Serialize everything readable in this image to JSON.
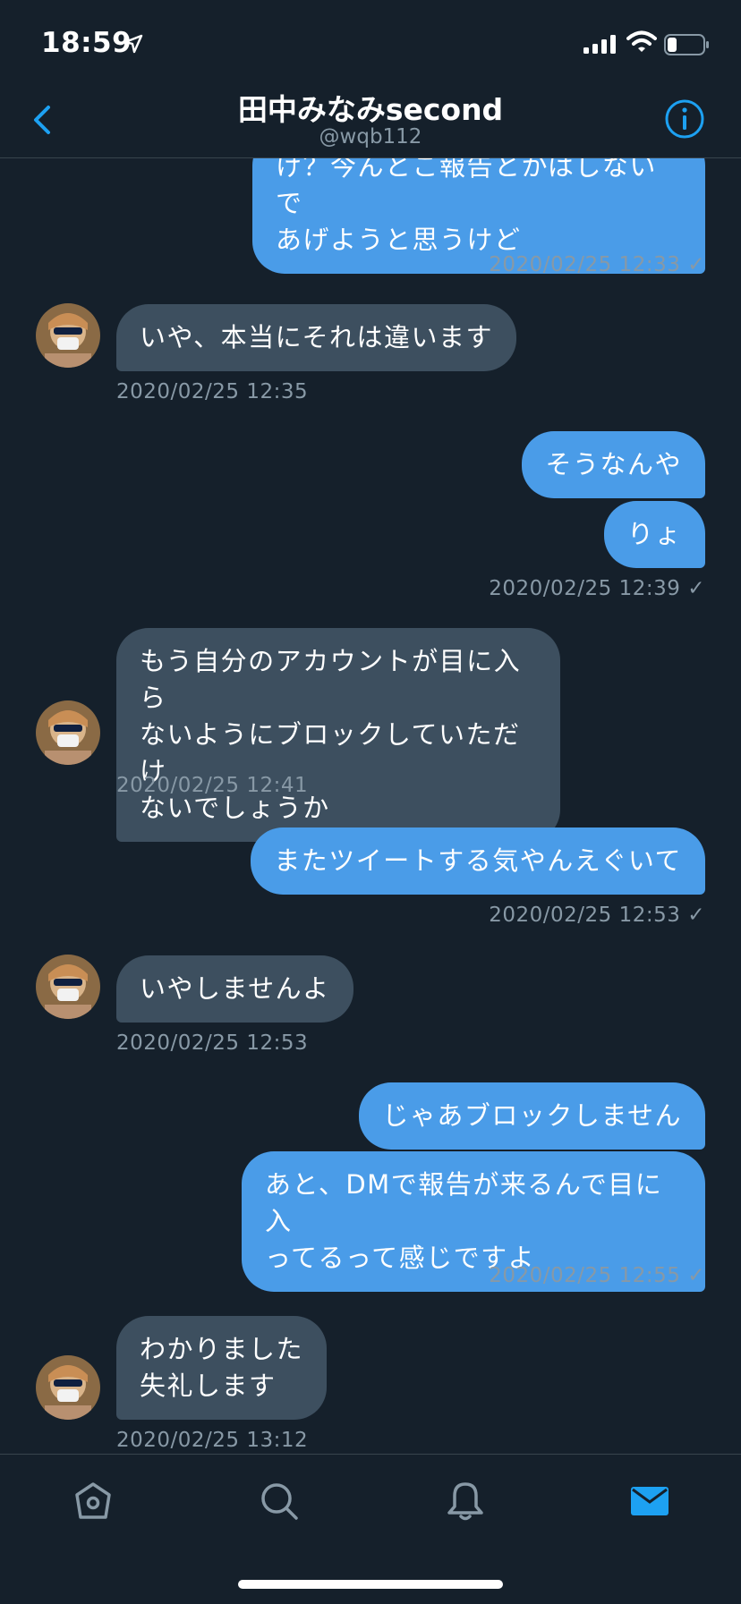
{
  "status_bar": {
    "time": "18:59",
    "icons": [
      "location-arrow-icon",
      "cellular-signal-icon",
      "wifi-icon",
      "battery-icon"
    ]
  },
  "header": {
    "title": "田中みなみsecond",
    "handle": "@wqb112",
    "back_icon": "chevron-left-icon",
    "info_icon": "info-icon"
  },
  "colors": {
    "background": "#15202b",
    "sent_bubble": "#4a9ce8",
    "received_bubble": "#3d4f5f",
    "accent": "#1da1f2",
    "muted_text": "#8899a6"
  },
  "conversation": [
    {
      "side": "sent",
      "text": "け？今んとこ報告とかはしないで\nあげようと思うけど"
    },
    {
      "side": "sent_ts",
      "timestamp": "2020/02/25 12:33 ✓"
    },
    {
      "side": "received",
      "text": "いや、本当にそれは違います"
    },
    {
      "side": "received_ts",
      "timestamp": "2020/02/25 12:35"
    },
    {
      "side": "sent",
      "text": "そうなんや"
    },
    {
      "side": "sent",
      "text": "りょ"
    },
    {
      "side": "sent_ts",
      "timestamp": "2020/02/25 12:39 ✓"
    },
    {
      "side": "received",
      "text": "もう自分のアカウントが目に入ら\nないようにブロックしていただけ\nないでしょうか"
    },
    {
      "side": "received_ts",
      "timestamp": "2020/02/25 12:41"
    },
    {
      "side": "sent",
      "text": "またツイートする気やんえぐいて"
    },
    {
      "side": "sent_ts",
      "timestamp": "2020/02/25 12:53 ✓"
    },
    {
      "side": "received",
      "text": "いやしませんよ"
    },
    {
      "side": "received_ts",
      "timestamp": "2020/02/25 12:53"
    },
    {
      "side": "sent",
      "text": "じゃあブロックしません"
    },
    {
      "side": "sent",
      "text": "あと、DMで報告が来るんで目に入\nってるって感じですよ"
    },
    {
      "side": "sent_ts",
      "timestamp": "2020/02/25 12:55 ✓"
    },
    {
      "side": "received",
      "text": "わかりました\n失礼します"
    },
    {
      "side": "received_ts",
      "timestamp": "2020/02/25 13:12"
    }
  ],
  "tab_bar": {
    "tabs": [
      {
        "icon": "home-icon"
      },
      {
        "icon": "search-icon"
      },
      {
        "icon": "notifications-bell-icon"
      },
      {
        "icon": "messages-envelope-icon",
        "active": true
      }
    ]
  }
}
